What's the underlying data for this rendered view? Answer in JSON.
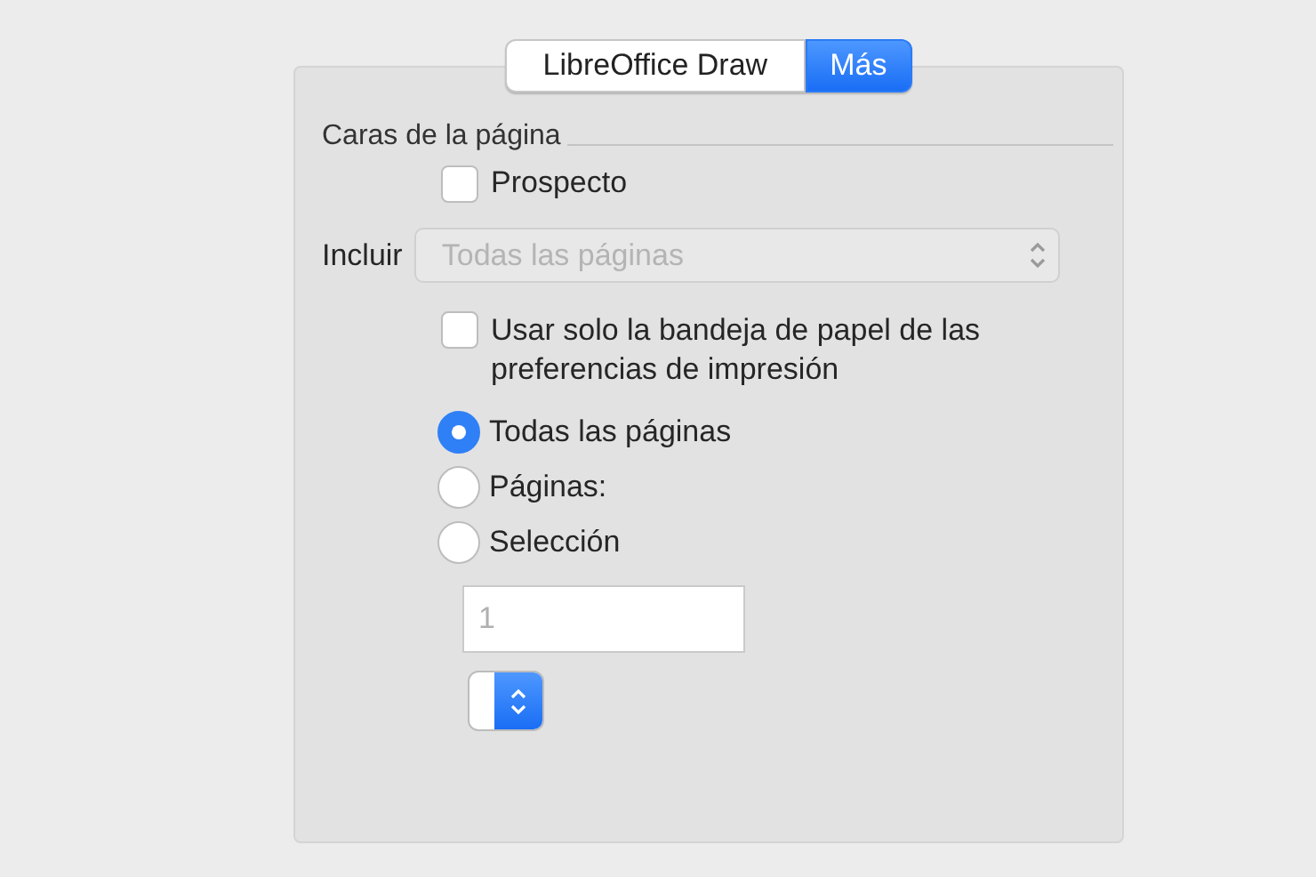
{
  "tabs": [
    {
      "label": "LibreOffice Draw",
      "selected": false
    },
    {
      "label": "Más",
      "selected": true
    }
  ],
  "section": {
    "title": "Caras de la página"
  },
  "brochure": {
    "label": "Prospecto",
    "checked": false
  },
  "include": {
    "label": "Incluir",
    "value": "Todas las páginas",
    "disabled": true
  },
  "paper_tray": {
    "label": "Usar solo la bandeja de papel de las preferencias de impresión",
    "checked": false
  },
  "range": [
    {
      "label": "Todas las páginas",
      "selected": true
    },
    {
      "label": "Páginas:",
      "selected": false
    },
    {
      "label": "Selección",
      "selected": false
    }
  ],
  "pages_field": {
    "placeholder": "1"
  },
  "stepper": {
    "kind": "popup"
  }
}
